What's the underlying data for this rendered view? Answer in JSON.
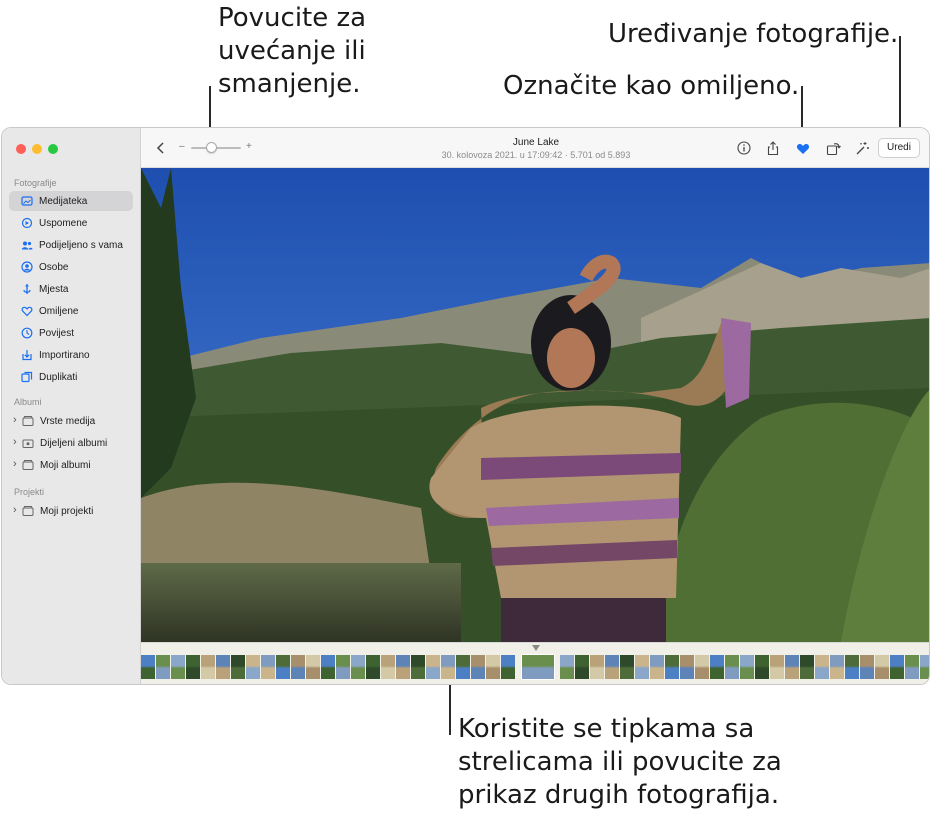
{
  "callouts": {
    "zoom": "Povucite za\nuvećanje ili\nsmanjenje.",
    "edit": "Uređivanje fotografije.",
    "favorite": "Označite kao omiljeno.",
    "browse": "Koristite se tipkama sa\nstrelicama ili povucite za\nprikaz drugih fotografija."
  },
  "sidebar": {
    "sections": {
      "photos": "Fotografije",
      "albums": "Albumi",
      "projects": "Projekti"
    },
    "items": [
      {
        "label": "Medijateka",
        "icon": "library-icon"
      },
      {
        "label": "Uspomene",
        "icon": "memories-icon"
      },
      {
        "label": "Podijeljeno s vama",
        "icon": "shared-with-you-icon"
      },
      {
        "label": "Osobe",
        "icon": "people-icon"
      },
      {
        "label": "Mjesta",
        "icon": "places-icon"
      },
      {
        "label": "Omiljene",
        "icon": "favorites-icon"
      },
      {
        "label": "Povijest",
        "icon": "recents-icon"
      },
      {
        "label": "Importirano",
        "icon": "imports-icon"
      },
      {
        "label": "Duplikati",
        "icon": "duplicates-icon"
      }
    ],
    "albums": [
      {
        "label": "Vrste medija"
      },
      {
        "label": "Dijeljeni albumi"
      },
      {
        "label": "Moji albumi"
      }
    ],
    "projects": [
      {
        "label": "Moji projekti"
      }
    ]
  },
  "toolbar": {
    "title": "June Lake",
    "subtitle": "30. kolovoza 2021. u 17:09:42   ·   5.701 od 5.893",
    "zoom_minus": "–",
    "zoom_plus": "+",
    "edit_label": "Uredi",
    "favorite_color": "#1a6ff2"
  },
  "colors": {
    "accent": "#1a6ff2",
    "sidebar_bg": "#e8e8e8"
  }
}
